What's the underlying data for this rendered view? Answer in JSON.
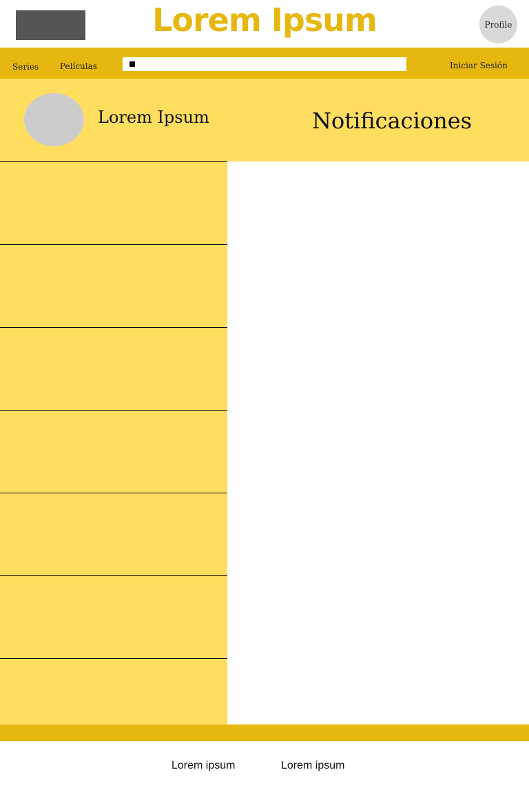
{
  "header": {
    "title": "Lorem Ipsum",
    "profile_label": "Profile"
  },
  "nav": {
    "series": "Series",
    "peliculas": "Películas",
    "login": "Iniciar Sesión",
    "search": {
      "value": "",
      "placeholder": ""
    }
  },
  "profile": {
    "name": "Lorem Ipsum",
    "section_title": "Notificaciones"
  },
  "sidebar": {
    "items": [
      "",
      "",
      "",
      "",
      "",
      "",
      ""
    ]
  },
  "footer": {
    "link_1": "Lorem ipsum",
    "link_2": "Lorem ipsum"
  },
  "colors": {
    "accent": "#e6b80f",
    "panel": "#ffde5f",
    "logo_placeholder": "#565454",
    "avatar": "#cccccc"
  }
}
